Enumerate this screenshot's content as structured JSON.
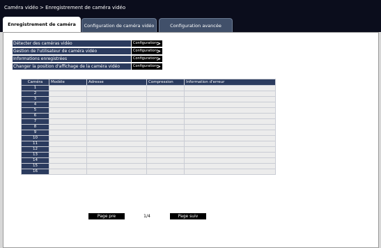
{
  "header": {
    "breadcrumb": "Caméra vidéo > Enregistrement de caméra vidéo"
  },
  "tabs": [
    {
      "label": "Enregistrement de caméra vidéo",
      "active": true
    },
    {
      "label": "Configuration de caméra vidéo",
      "active": false
    },
    {
      "label": "Configuration avancée",
      "active": false
    }
  ],
  "menu": {
    "button_label": "Configuration",
    "button_arrow": ">",
    "items": [
      {
        "label": "Détecter des caméras vidéo"
      },
      {
        "label": "Gestion de l'utilisateur de caméra vidéo"
      },
      {
        "label": "Informations enregistrées"
      },
      {
        "label": "Changer la position d'affichage de la caméra vidéo"
      }
    ]
  },
  "table": {
    "columns": [
      "Caméra",
      "Modèle",
      "Adresse",
      "Compression",
      "Information d'erreur"
    ],
    "rows": [
      "1",
      "2",
      "3",
      "4",
      "5",
      "6",
      "7",
      "8",
      "9",
      "10",
      "11",
      "12",
      "13",
      "14",
      "15",
      "16"
    ]
  },
  "pager": {
    "prev_label": "Page pre",
    "page_indicator": "1/4",
    "next_label": "Page suiv"
  }
}
